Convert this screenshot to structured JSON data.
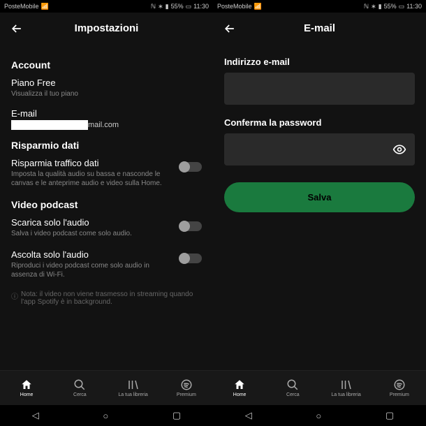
{
  "status": {
    "carrier": "PosteMobile",
    "battery": "55%",
    "time": "11:30"
  },
  "left": {
    "title": "Impostazioni",
    "sections": {
      "account": {
        "heading": "Account",
        "plan_title": "Piano Free",
        "plan_sub": "Visualizza il tuo piano",
        "email_label": "E-mail",
        "email_tail": "mail.com"
      },
      "data": {
        "heading": "Risparmio dati",
        "item_title": "Risparmia traffico dati",
        "item_sub": "Imposta la qualità audio su bassa e nasconde le canvas e le anteprime audio e video sulla Home."
      },
      "video": {
        "heading": "Video podcast",
        "download_title": "Scarica solo l'audio",
        "download_sub": "Salva i video podcast come solo audio.",
        "listen_title": "Ascolta solo l'audio",
        "listen_sub": "Riproduci i video podcast come solo audio in assenza di Wi-Fi.",
        "note": "Nota: il video non viene trasmesso in streaming quando l'app Spotify è in background."
      }
    }
  },
  "right": {
    "title": "E-mail",
    "email_label": "Indirizzo e-mail",
    "password_label": "Conferma la password",
    "save": "Salva"
  },
  "tabs": [
    {
      "label": "Home"
    },
    {
      "label": "Cerca"
    },
    {
      "label": "La tua libreria"
    },
    {
      "label": "Premium"
    }
  ]
}
